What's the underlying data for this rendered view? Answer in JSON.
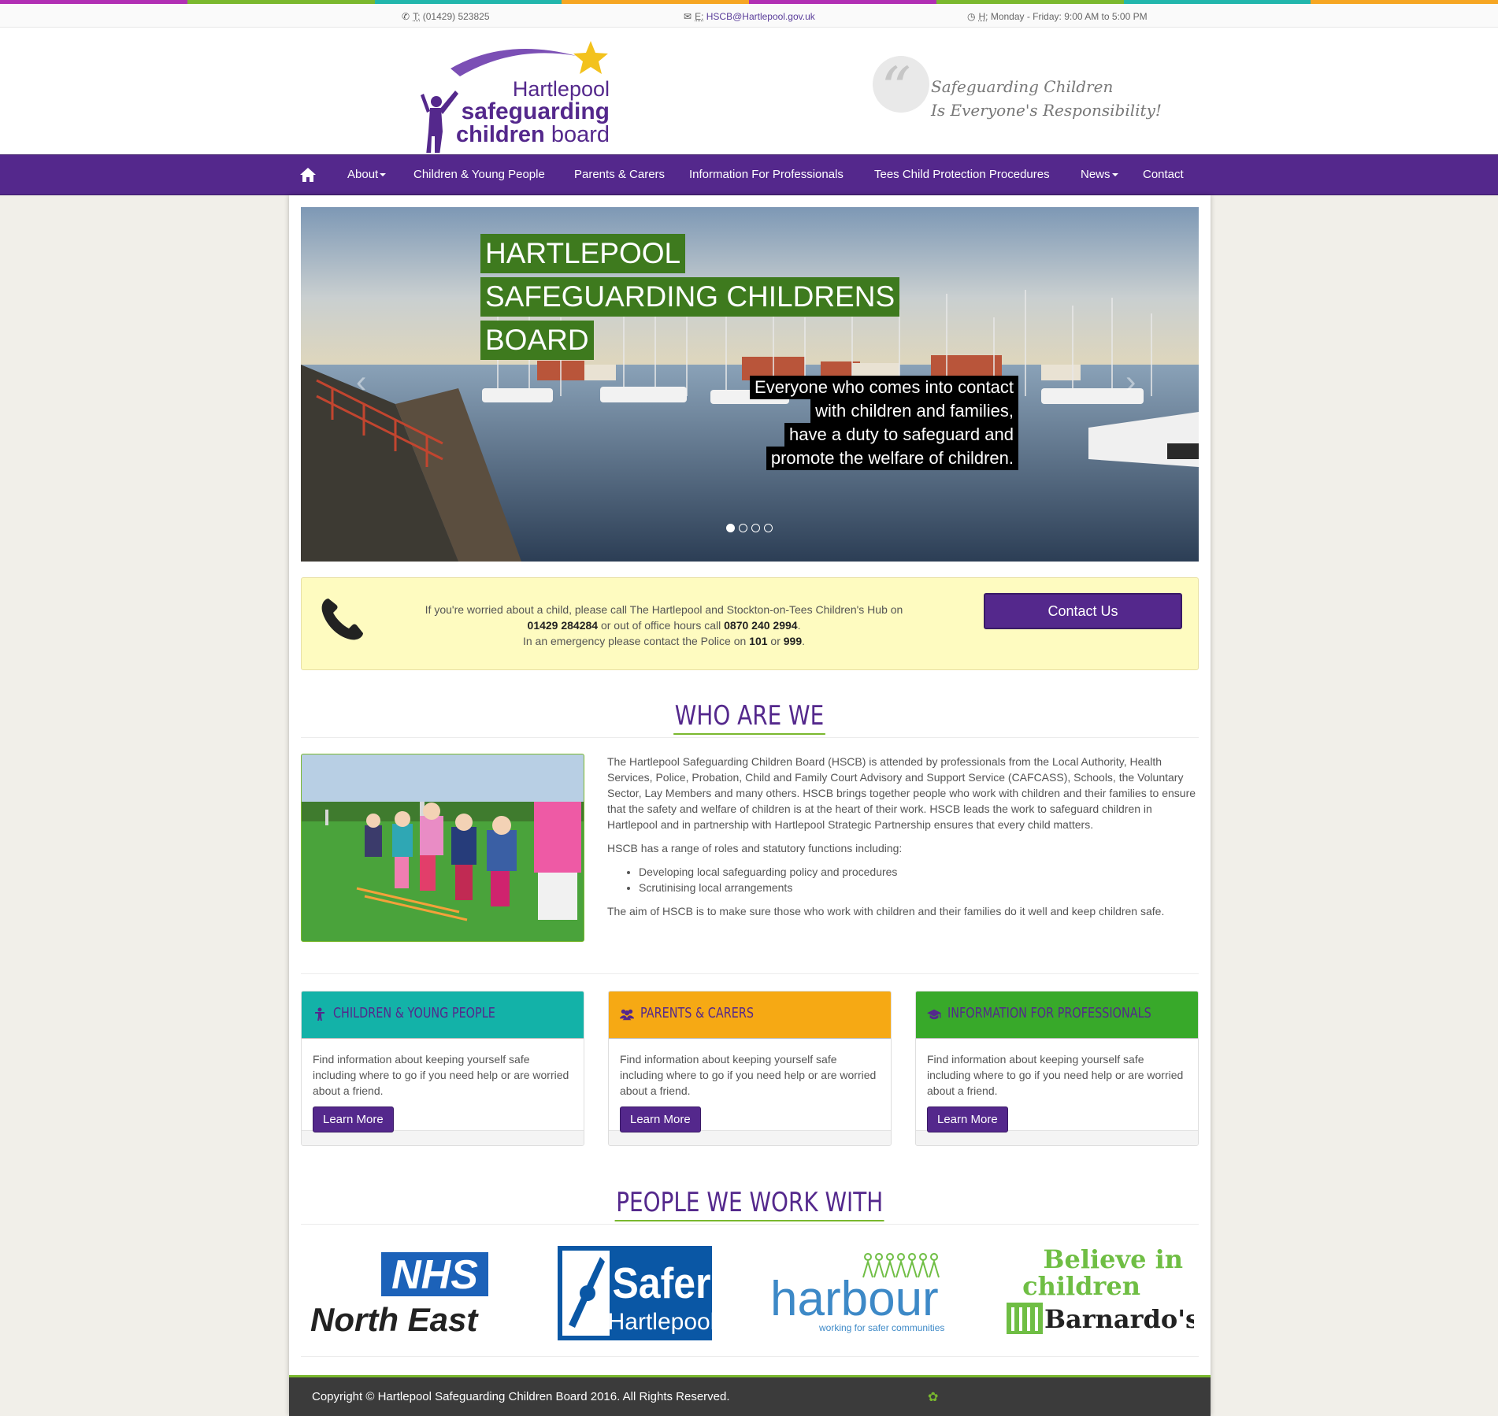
{
  "colors": {
    "brand_purple": "#54288c",
    "accent_green": "#7ab82e",
    "rainbow": [
      "#b12fb4",
      "#7ab82e",
      "#21b6ac",
      "#f6a623",
      "#b12fb4",
      "#7ab82e",
      "#21b6ac",
      "#f6a623"
    ]
  },
  "topbar": {
    "phone_label": "T:",
    "phone": "(01429) 523825",
    "email_label": "E:",
    "email": "HSCB@Hartlepool.gov.uk",
    "hours_label": "H:",
    "hours": "Monday - Friday: 9:00 AM to 5:00 PM"
  },
  "header": {
    "logo_line1": "Hartlepool",
    "logo_line2": "safeguarding",
    "logo_line3a": "children",
    "logo_line3b": "board",
    "quote_line1": "Safeguarding Children",
    "quote_line2": "Is Everyone's Responsibility!"
  },
  "nav": {
    "items": [
      {
        "label": "About",
        "dropdown": true
      },
      {
        "label": "Children & Young People",
        "dropdown": false
      },
      {
        "label": "Parents & Carers",
        "dropdown": false
      },
      {
        "label": "Information For Professionals",
        "dropdown": false
      },
      {
        "label": "Tees Child Protection Procedures",
        "dropdown": false
      },
      {
        "label": "News",
        "dropdown": true
      },
      {
        "label": "Contact",
        "dropdown": false
      }
    ]
  },
  "slider": {
    "title_lines": [
      "HARTLEPOOL",
      "SAFEGUARDING CHILDRENS",
      "BOARD"
    ],
    "caption_lines": [
      "Everyone who comes into contact",
      "with children and families,",
      "have a duty to safeguard and",
      "promote the welfare of children."
    ],
    "slide_count": 4,
    "active_slide": 1,
    "prev_glyph": "‹",
    "next_glyph": "›"
  },
  "alert": {
    "line1": "If you're worried about a child, please call The Hartlepool and Stockton-on-Tees Children's Hub on",
    "hub_number": "01429 284284",
    "line2_mid": " or out of office hours call ",
    "ooh_number": "0870 240 2994",
    "line2_end": ".",
    "line3_start": "In an emergency please contact the Police on ",
    "police_101": "101",
    "line3_or": " or ",
    "police_999": "999",
    "line3_end": ".",
    "button": "Contact Us"
  },
  "who": {
    "heading": "WHO ARE WE",
    "para1": "The Hartlepool Safeguarding Children Board (HSCB) is attended by professionals from the Local Authority, Health Services, Police, Probation, Child and Family Court Advisory and Support Service (CAFCASS), Schools, the Voluntary Sector, Lay Members and many others. HSCB brings together people who work with children and their families to ensure that the safety and welfare of children is at the heart of their work. HSCB leads the work to safeguard children in Hartlepool and in partnership with Hartlepool Strategic Partnership ensures that every child matters.",
    "para2": "HSCB has a range of roles and statutory functions including:",
    "bullets": [
      "Developing local safeguarding policy and procedures",
      "Scrutinising local arrangements"
    ],
    "para3": "The aim of HSCB is to make sure those who work with children and their families do it well and keep children safe."
  },
  "cards": [
    {
      "title": "CHILDREN & YOUNG PEOPLE",
      "icon": "child-icon",
      "color": "#13b2a8",
      "title_color": "#54288c",
      "body": "Find information about keeping yourself safe including where to go if you need help or are worried about a friend.",
      "button": "Learn More"
    },
    {
      "title": "PARENTS & CARERS",
      "icon": "users-icon",
      "color": "#f6a914",
      "title_color": "#54288c",
      "body": "Find information about keeping yourself safe including where to go if you need help or are worried about a friend.",
      "button": "Learn More"
    },
    {
      "title": "INFORMATION FOR PROFESSIONALS",
      "icon": "graduation-cap-icon",
      "color": "#38a92a",
      "title_color": "#54288c",
      "body": "Find information about keeping yourself safe including where to go if you need help or are worried about a friend.",
      "button": "Learn More"
    }
  ],
  "partners": {
    "heading": "PEOPLE WE WORK WITH",
    "nhs_badge": "NHS",
    "nhs_region": "North East",
    "safer_line1": "Safer",
    "safer_line2": "Hartlepool",
    "harbour_name": "harbour",
    "harbour_tag": "working for safer communities",
    "barnardos_line1": "Believe in",
    "barnardos_line2": "children",
    "barnardos_name": "Barnardo's"
  },
  "footer": {
    "copyright": "Copyright © Hartlepool Safeguarding Children Board 2016. All Rights Reserved."
  }
}
